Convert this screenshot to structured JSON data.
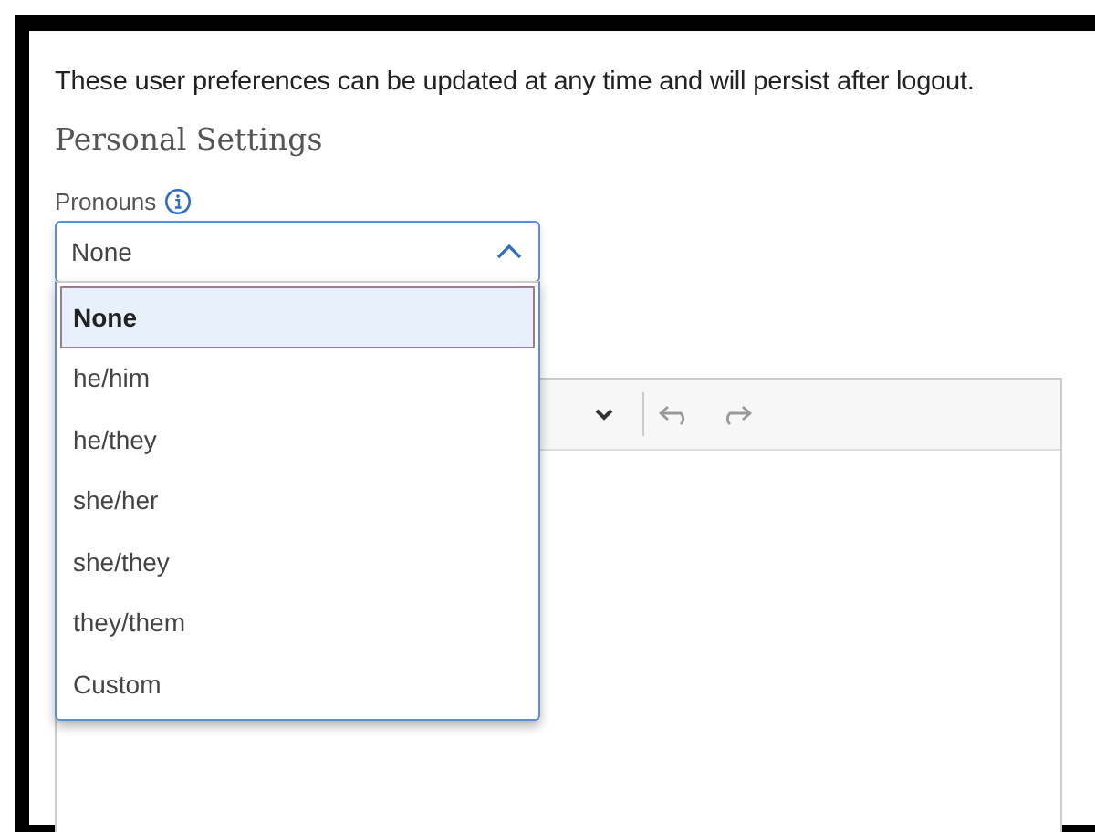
{
  "intro": "These user preferences can be updated at any time and will persist after logout.",
  "section_title": "Personal Settings",
  "pronouns": {
    "label": "Pronouns",
    "value": "None",
    "expanded": true,
    "options": [
      {
        "label": "None",
        "selected": true
      },
      {
        "label": "he/him",
        "selected": false
      },
      {
        "label": "he/they",
        "selected": false
      },
      {
        "label": "she/her",
        "selected": false
      },
      {
        "label": "she/they",
        "selected": false
      },
      {
        "label": "they/them",
        "selected": false
      },
      {
        "label": "Custom",
        "selected": false
      }
    ]
  }
}
